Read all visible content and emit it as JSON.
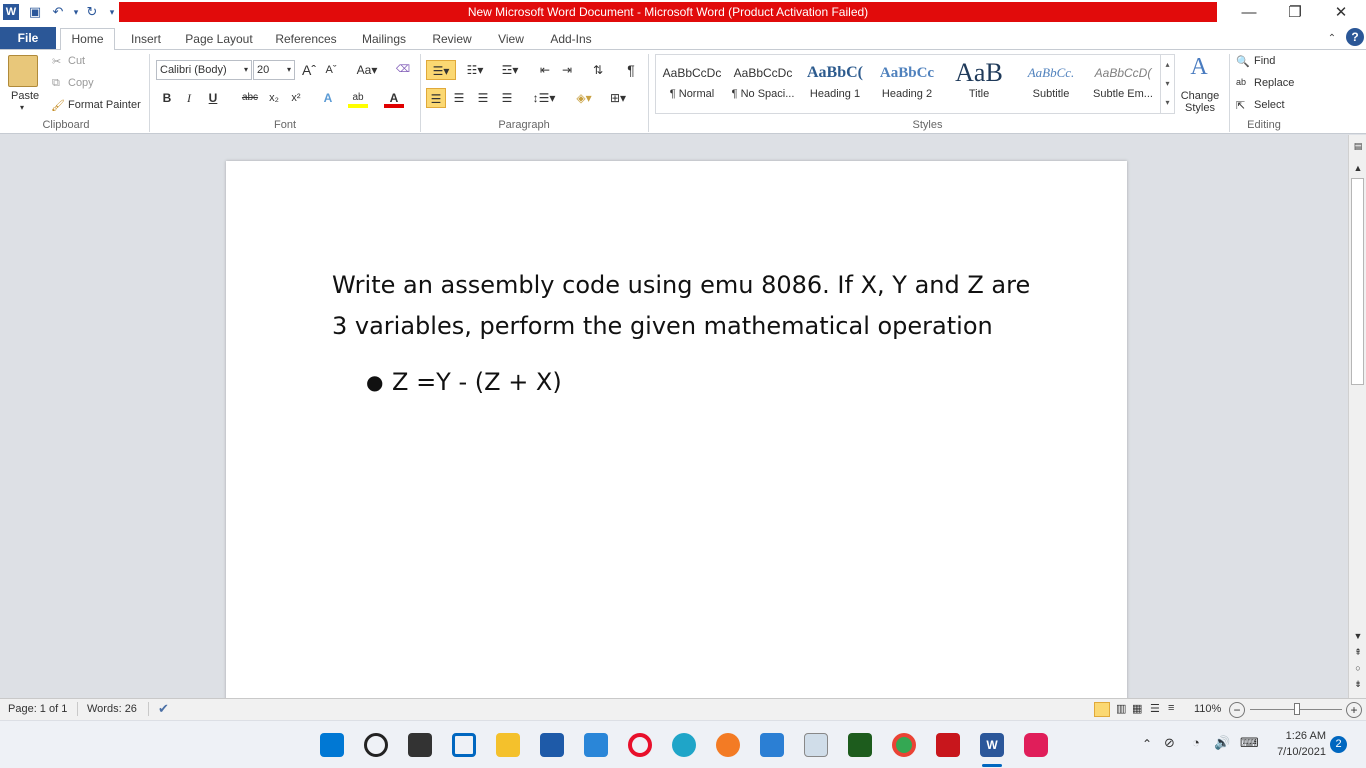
{
  "titlebar": {
    "title": "New Microsoft Word Document  -  Microsoft Word (Product Activation Failed)",
    "title_bg": "#e10b0b"
  },
  "tabs": [
    "File",
    "Home",
    "Insert",
    "Page Layout",
    "References",
    "Mailings",
    "Review",
    "View",
    "Add-Ins"
  ],
  "active_tab": "Home",
  "clipboard": {
    "paste": "Paste",
    "cut": "Cut",
    "copy": "Copy",
    "format_painter": "Format Painter",
    "group": "Clipboard"
  },
  "font": {
    "name": "Calibri (Body)",
    "size": "20",
    "group": "Font",
    "aa": "Aa"
  },
  "paragraph": {
    "group": "Paragraph"
  },
  "styles": {
    "group": "Styles",
    "items": [
      {
        "preview": "AaBbCcDc",
        "name": "¶ Normal"
      },
      {
        "preview": "AaBbCcDc",
        "name": "¶ No Spaci..."
      },
      {
        "preview": "AaBbC(",
        "name": "Heading 1"
      },
      {
        "preview": "AaBbCc",
        "name": "Heading 2"
      },
      {
        "preview": "AaB",
        "name": "Title"
      },
      {
        "preview": "AaBbCc.",
        "name": "Subtitle"
      },
      {
        "preview": "AaBbCcD(",
        "name": "Subtle Em..."
      }
    ],
    "change_styles": "Change Styles"
  },
  "editing": {
    "group": "Editing",
    "find": "Find",
    "replace": "Replace",
    "select": "Select"
  },
  "document": {
    "paragraph": "Write an assembly code using emu 8086. If X, Y and Z are 3 variables, perform the given mathematical operation",
    "bullet": "Z =Y - (Z + X)"
  },
  "status": {
    "page": "Page: 1 of 1",
    "words": "Words: 26",
    "zoom": "110%"
  },
  "taskbar": {
    "time": "1:26 AM",
    "date": "7/10/2021",
    "badge": "2"
  }
}
